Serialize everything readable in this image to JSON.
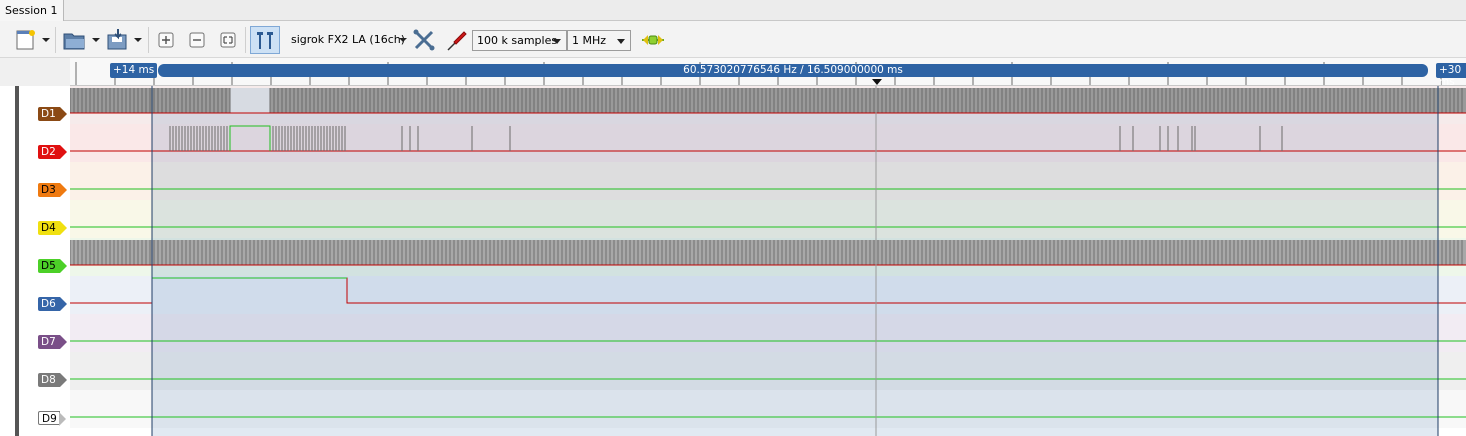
{
  "session_tab": "Session 1",
  "toolbar": {
    "device": "sigrok FX2 LA (16ch)",
    "samples": "100 k samples",
    "samplerate": "1 MHz",
    "icons": [
      "new-session-icon",
      "open-file-icon",
      "save-file-icon",
      "zoom-in-icon",
      "zoom-out-icon",
      "zoom-fit-icon",
      "show-cursors-icon",
      "device-config-icon",
      "probe-icon",
      "run-icon"
    ]
  },
  "ruler": {
    "left_marker": "+14 ms",
    "right_marker": "+30 ms",
    "cursor_readout": "60.573020776546 Hz / 16.509000000 ms"
  },
  "channels": [
    {
      "name": "D1",
      "color": "#8b4a15",
      "text_color": "#ffffff"
    },
    {
      "name": "D2",
      "color": "#e01010",
      "text_color": "#ffffff"
    },
    {
      "name": "D3",
      "color": "#ef7a10",
      "text_color": "#000000"
    },
    {
      "name": "D4",
      "color": "#f0e010",
      "text_color": "#000000"
    },
    {
      "name": "D5",
      "color": "#4cd028",
      "text_color": "#000000"
    },
    {
      "name": "D6",
      "color": "#3565a8",
      "text_color": "#ffffff"
    },
    {
      "name": "D7",
      "color": "#7a4f88",
      "text_color": "#ffffff"
    },
    {
      "name": "D8",
      "color": "#7a7a7a",
      "text_color": "#ffffff"
    },
    {
      "name": "D9",
      "color": "#ffffff",
      "text_color": "#000000"
    }
  ],
  "colors": {
    "accent": "#2e63a4",
    "high_level": "#20c020",
    "low_level": "#c00000"
  }
}
